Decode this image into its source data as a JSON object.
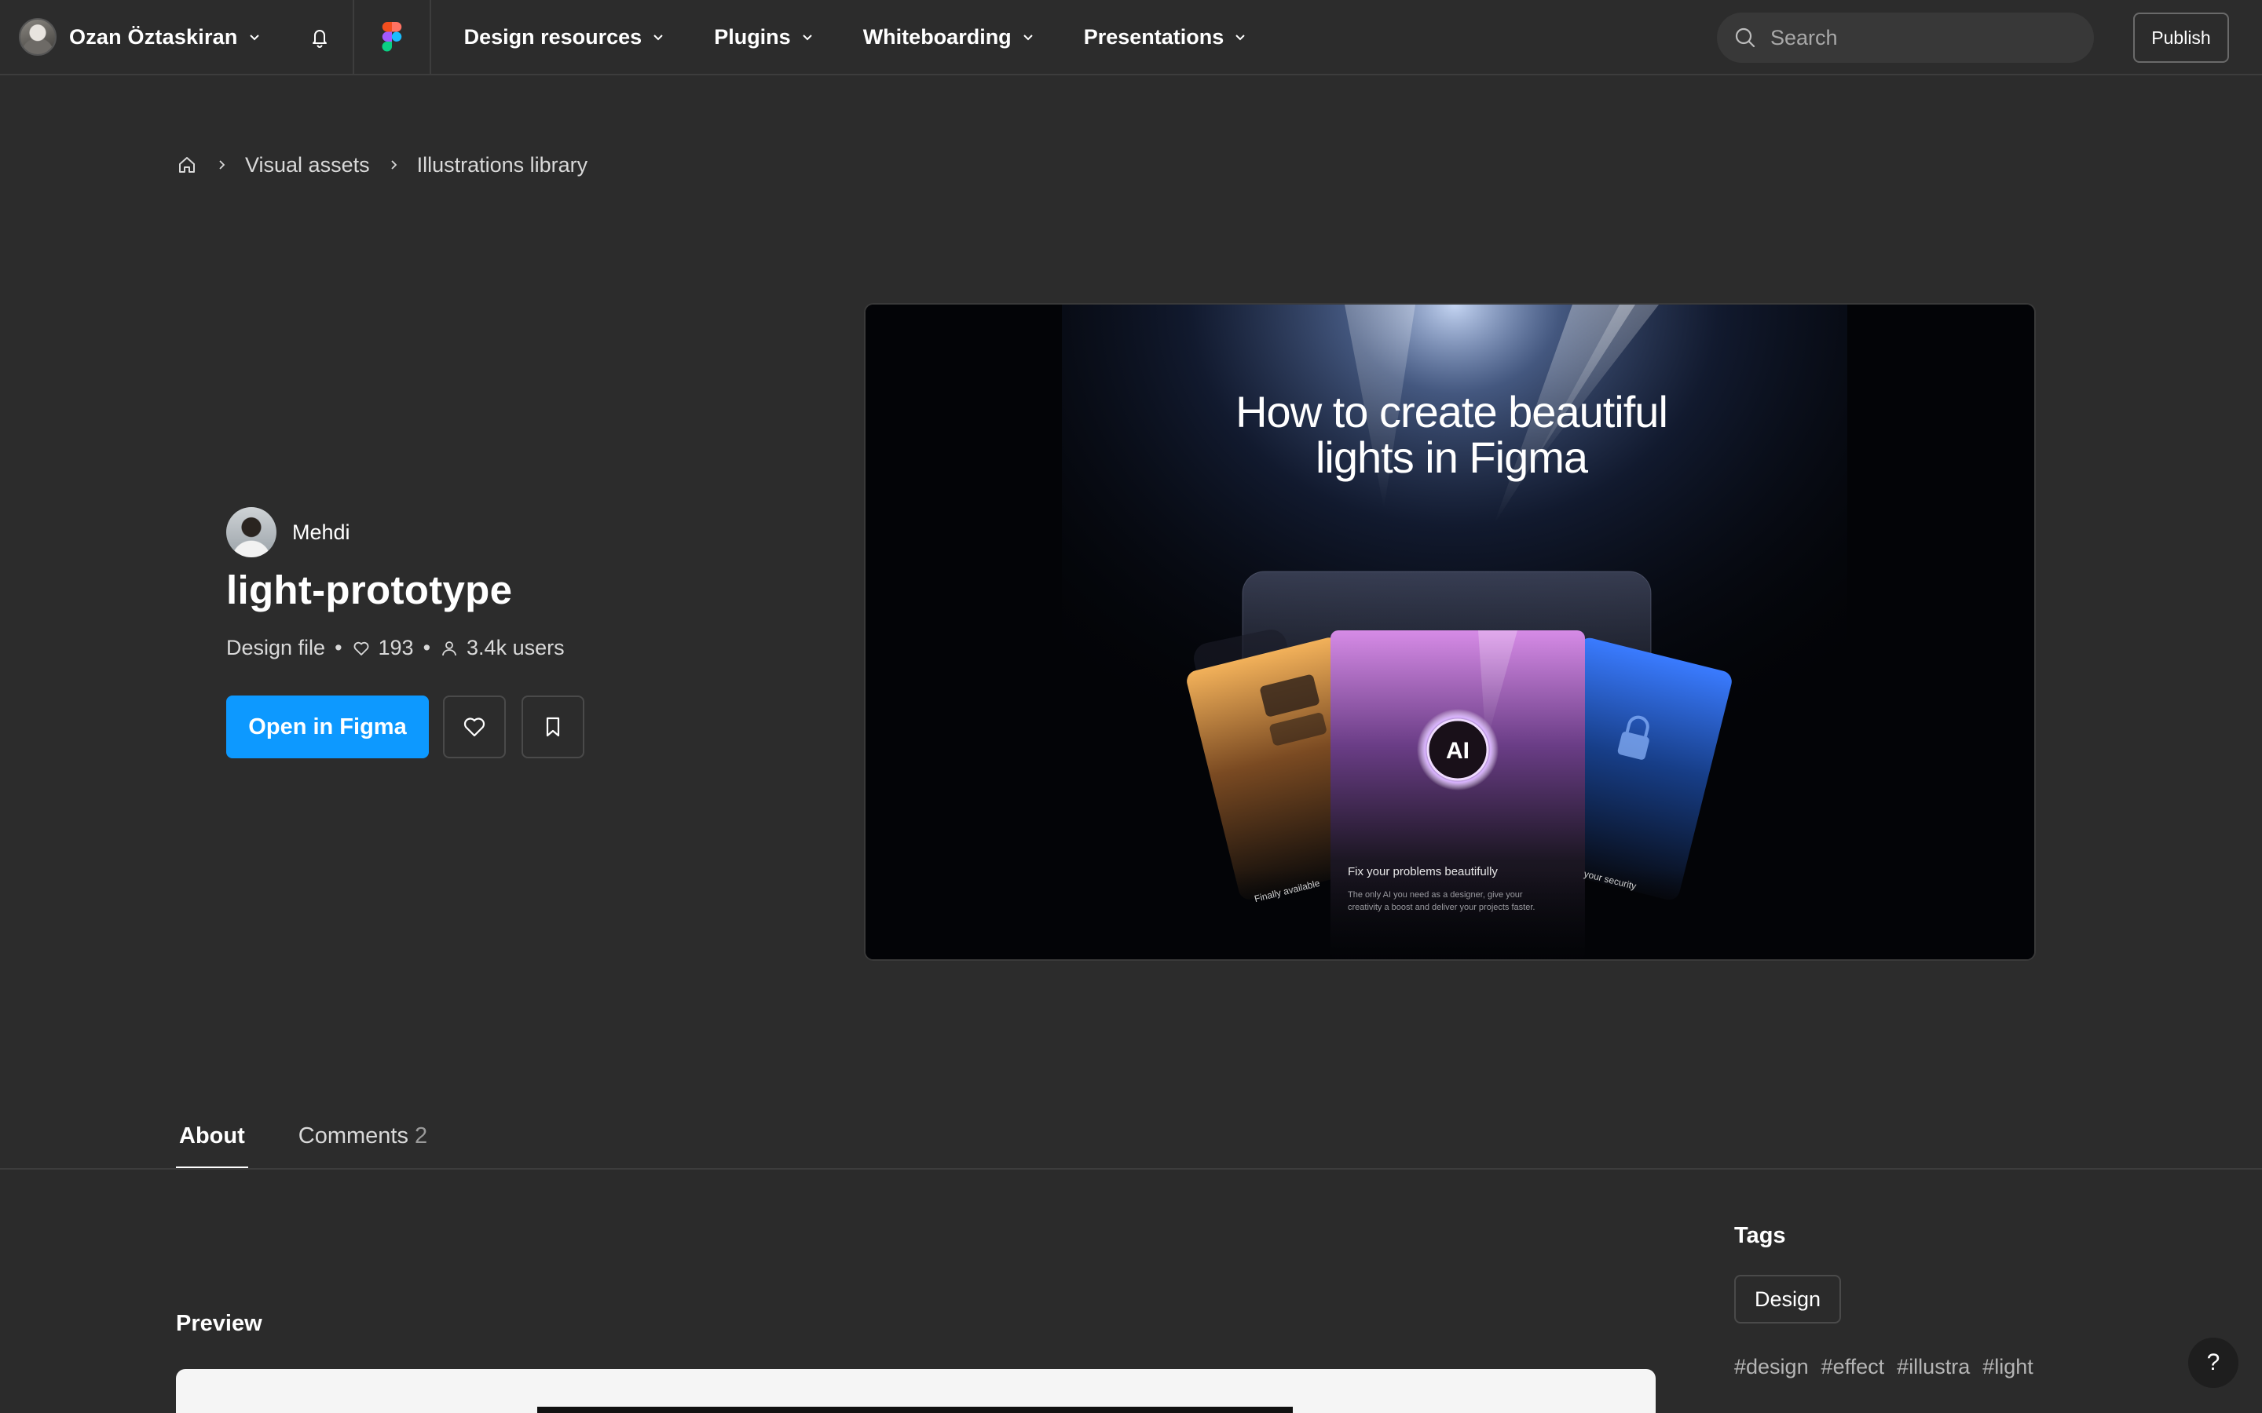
{
  "topnav": {
    "user_name": "Ozan Öztaskiran",
    "links": [
      "Design resources",
      "Plugins",
      "Whiteboarding",
      "Presentations"
    ],
    "search_placeholder": "Search",
    "publish_label": "Publish"
  },
  "breadcrumb": [
    "Visual assets",
    "Illustrations library"
  ],
  "file": {
    "author": "Mehdi",
    "title": "light-prototype",
    "type": "Design file",
    "likes": "193",
    "users": "3.4k users",
    "open_label": "Open in Figma"
  },
  "hero": {
    "title_line1": "How to create beautiful",
    "title_line2": "lights in Figma",
    "badge": "AI",
    "center_caption": "Fix your problems beautifully",
    "center_sub1": "The only AI you need as a designer, give your",
    "center_sub2": "creativity a boost and deliver your projects faster.",
    "left_caption": "Finally available",
    "right_caption": "your security"
  },
  "tabs": [
    {
      "label": "About"
    },
    {
      "label": "Comments",
      "count": "2"
    }
  ],
  "tags": {
    "heading": "Tags",
    "pill": "Design",
    "hashtags": [
      "#design",
      "#effect",
      "#illustra",
      "#light"
    ]
  },
  "preview_heading": "Preview",
  "help_label": "?",
  "colors": {
    "background": "#2c2c2c",
    "accent": "#0d99ff",
    "text": "#ffffff",
    "muted": "#d9d9d9"
  },
  "icons": [
    "avatar",
    "chevron-down-icon",
    "bell-icon",
    "figma-logo-icon",
    "search-icon",
    "home-icon",
    "chevron-right-icon",
    "heart-icon",
    "user-icon",
    "bookmark-icon",
    "help-icon"
  ]
}
